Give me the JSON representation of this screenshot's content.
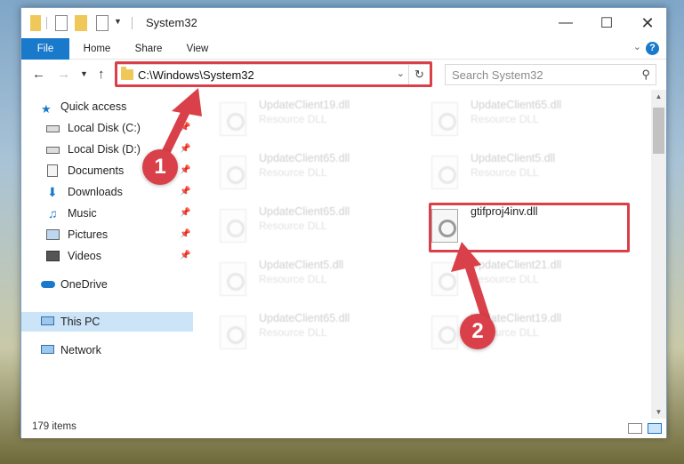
{
  "window": {
    "title": "System32"
  },
  "ribbon": {
    "tabs": [
      "File",
      "Home",
      "Share",
      "View"
    ],
    "help": "?"
  },
  "navigation": {
    "address": "C:\\Windows\\System32",
    "search_placeholder": "Search System32"
  },
  "sidebar": {
    "items": [
      {
        "label": "Quick access"
      },
      {
        "label": "Local Disk (C:)"
      },
      {
        "label": "Local Disk (D:)"
      },
      {
        "label": "Documents"
      },
      {
        "label": "Downloads"
      },
      {
        "label": "Music"
      },
      {
        "label": "Pictures"
      },
      {
        "label": "Videos"
      },
      {
        "label": "OneDrive"
      },
      {
        "label": "This PC"
      },
      {
        "label": "Network"
      }
    ]
  },
  "files": [
    {
      "name": "UpdateClient19.dll",
      "desc": "Resource DLL"
    },
    {
      "name": "UpdateClient65.dll",
      "desc": "Resource DLL"
    },
    {
      "name": "UpdateClient65.dll",
      "desc": "Resource DLL"
    },
    {
      "name": "UpdateClient5.dll",
      "desc": "Resource DLL"
    },
    {
      "name": "UpdateClient65.dll",
      "desc": "Resource DLL"
    },
    {
      "name": "gtifproj4inv.dll",
      "desc": ""
    },
    {
      "name": "UpdateClient5.dll",
      "desc": "Resource DLL"
    },
    {
      "name": "UpdateClient21.dll",
      "desc": "Resource DLL"
    },
    {
      "name": "UpdateClient65.dll",
      "desc": "Resource DLL"
    },
    {
      "name": "UpdateClient19.dll",
      "desc": "Resource DLL"
    }
  ],
  "status": {
    "items": "179 items"
  },
  "annotations": {
    "step1": "1",
    "step2": "2",
    "color": "#d9404a"
  }
}
